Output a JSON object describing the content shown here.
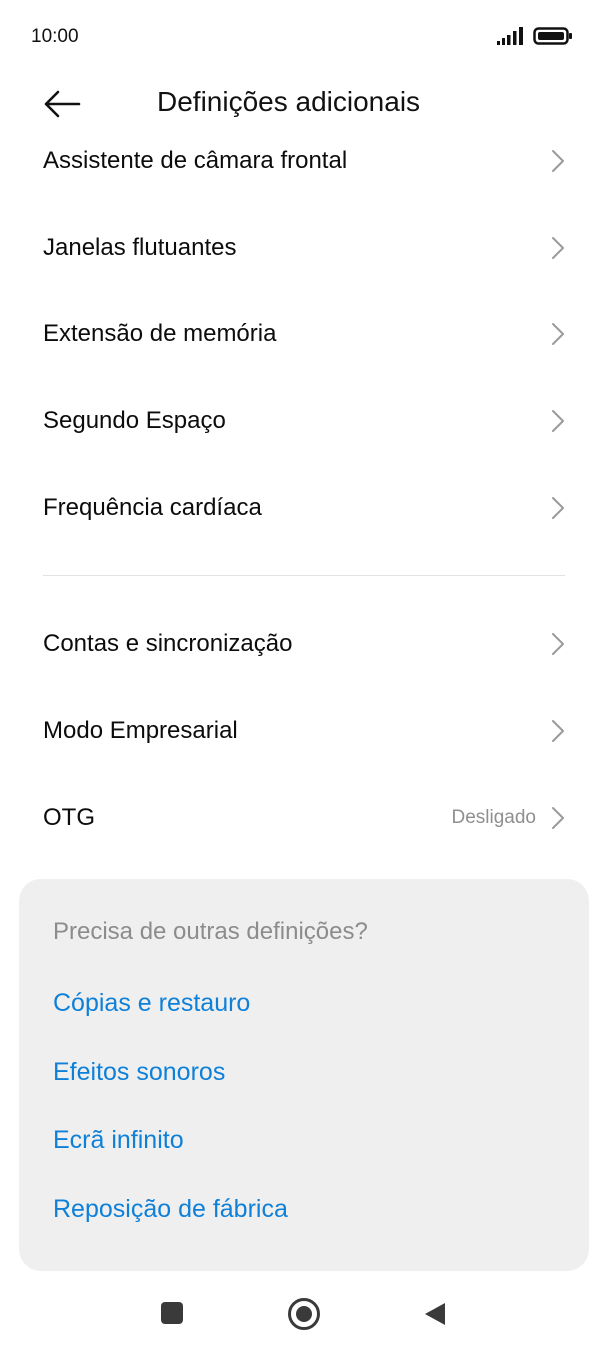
{
  "status_bar": {
    "time": "10:00",
    "signal_icon": "signal-bars-icon",
    "battery_icon": "battery-full-icon"
  },
  "header": {
    "back_icon": "arrow-left-icon",
    "title": "Definições adicionais"
  },
  "items": [
    {
      "label": "Assistente de câmara frontal",
      "value": ""
    },
    {
      "label": "Janelas flutuantes",
      "value": ""
    },
    {
      "label": "Extensão de memória",
      "value": ""
    },
    {
      "label": "Segundo Espaço",
      "value": ""
    },
    {
      "label": "Frequência cardíaca",
      "value": ""
    },
    {
      "label": "Contas e sincronização",
      "value": ""
    },
    {
      "label": "Modo Empresarial",
      "value": ""
    },
    {
      "label": "OTG",
      "value": "Desligado"
    }
  ],
  "suggestions": {
    "heading": "Precisa de outras definições?",
    "links": [
      "Cópias e restauro",
      "Efeitos sonoros",
      "Ecrã infinito",
      "Reposição de fábrica"
    ]
  },
  "nav_bar": {
    "recents_icon": "square-icon",
    "home_icon": "circle-home-icon",
    "back_icon": "triangle-back-icon"
  },
  "colors": {
    "link": "#0f80d8",
    "card_background": "#efefef",
    "secondary_text": "#8c8c8c"
  }
}
